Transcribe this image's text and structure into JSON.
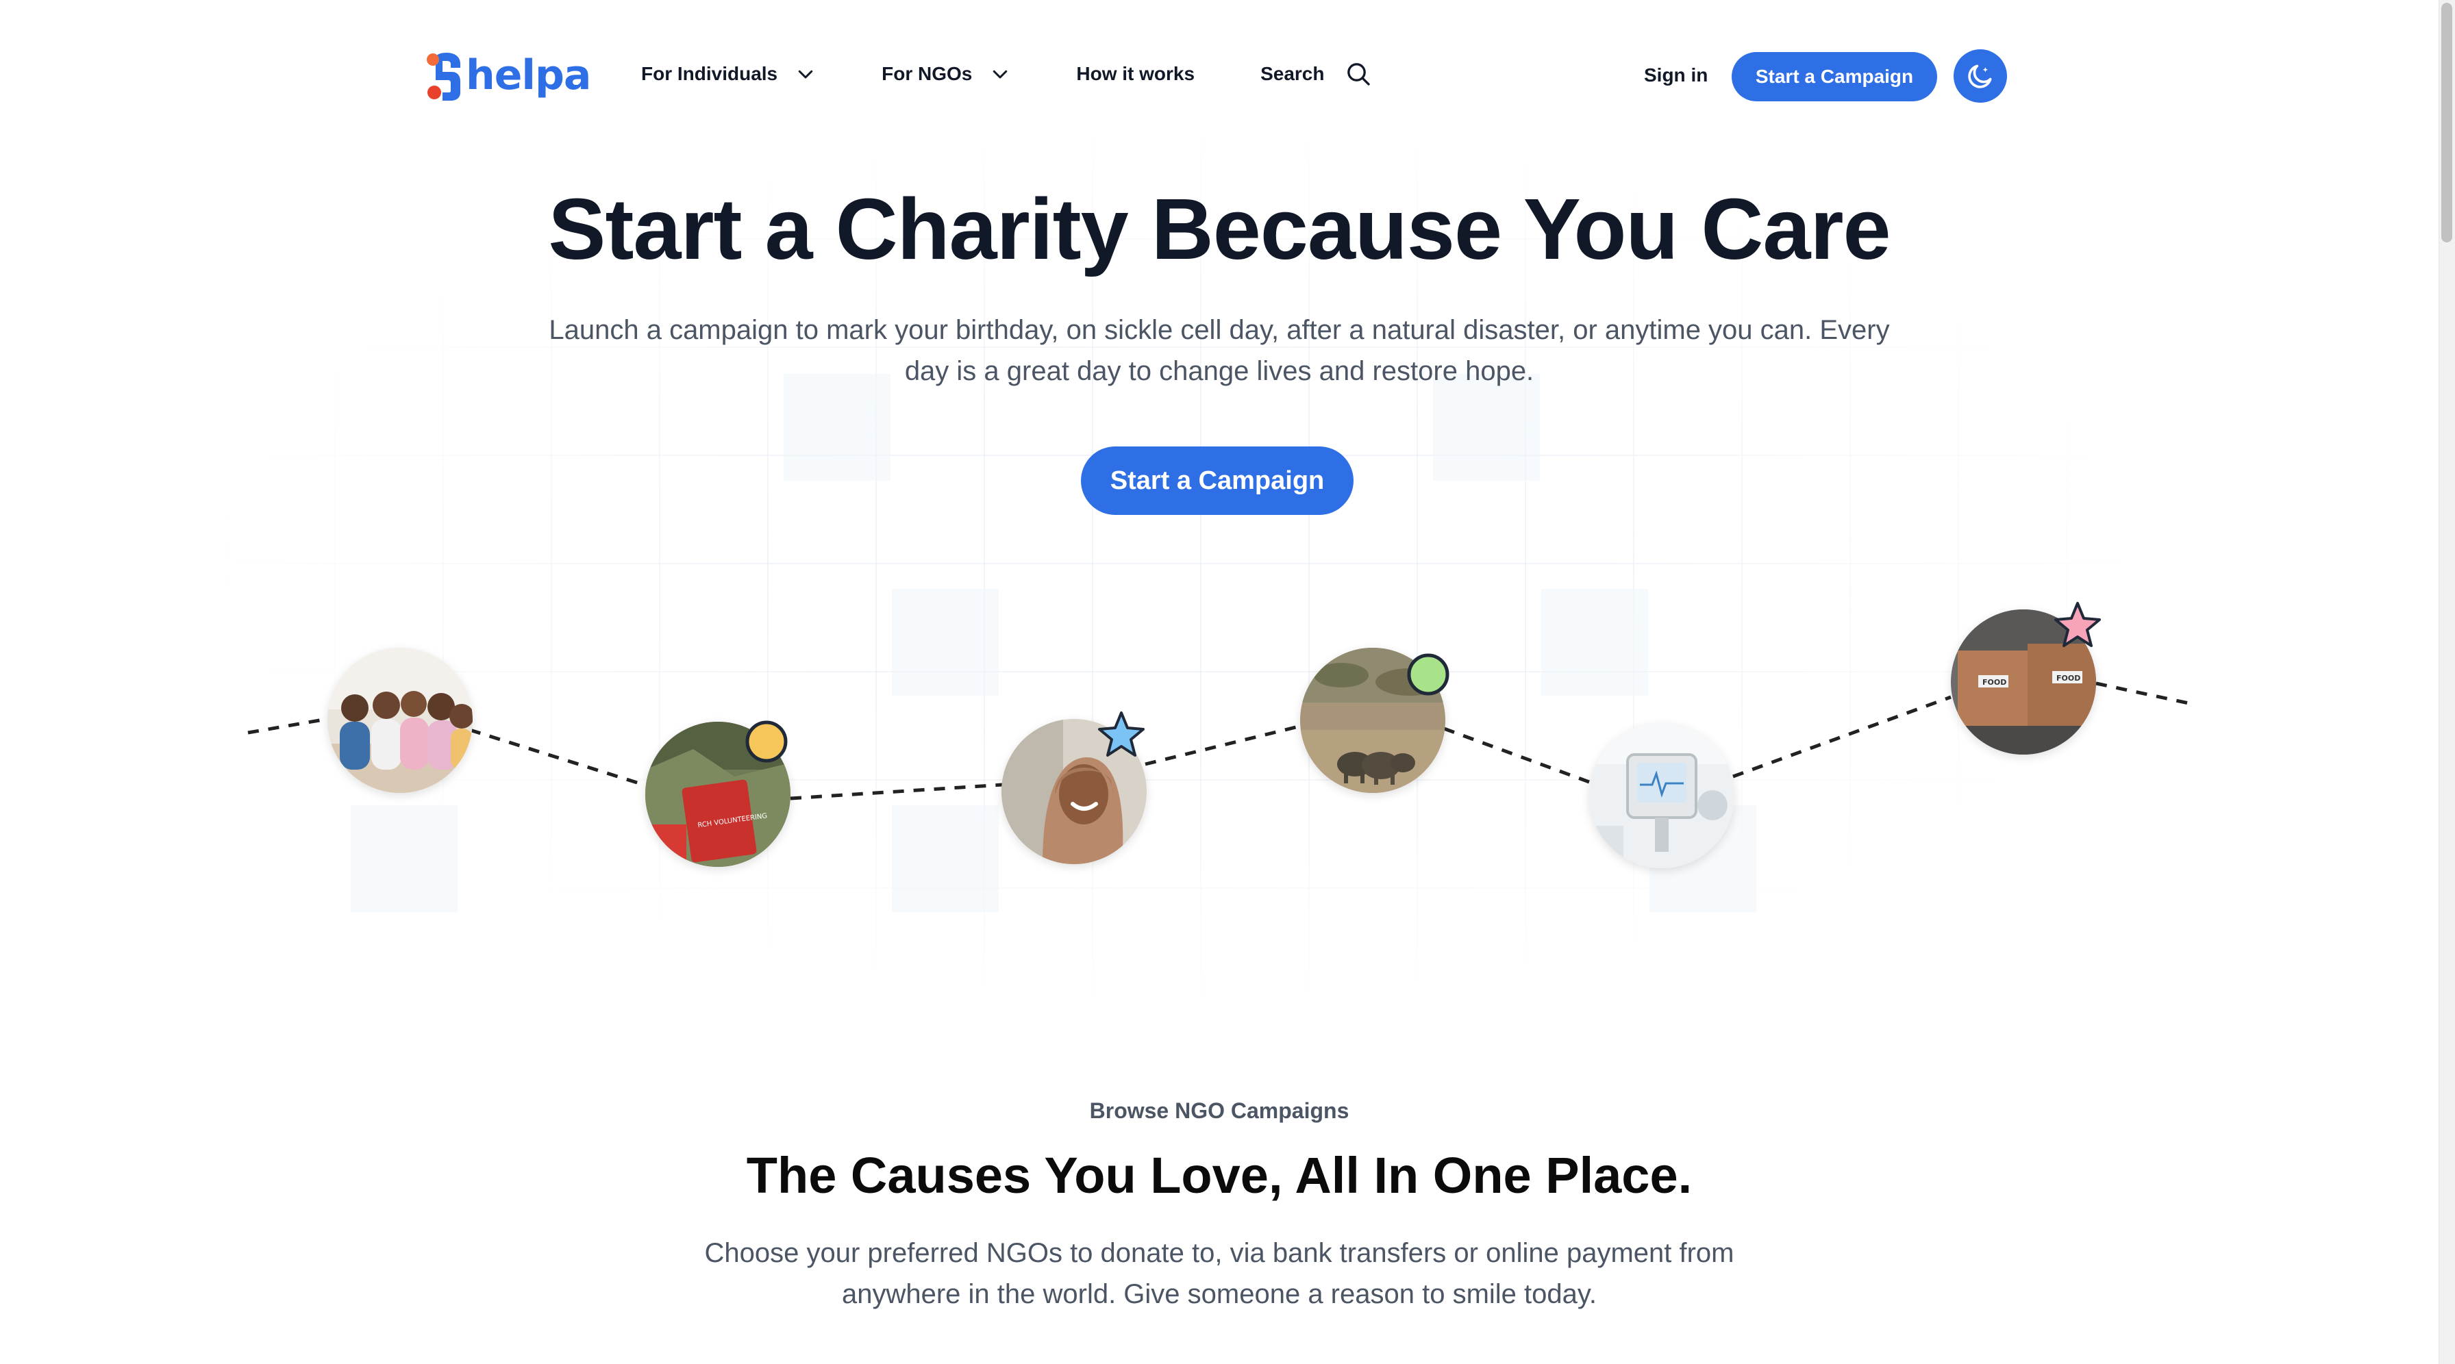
{
  "brand": {
    "name": "helpa",
    "primary_color": "#2f6fe6"
  },
  "nav": {
    "items": [
      {
        "label": "For Individuals",
        "has_dropdown": true
      },
      {
        "label": "For NGOs",
        "has_dropdown": true
      },
      {
        "label": "How it works",
        "has_dropdown": false
      },
      {
        "label": "Search",
        "icon": "search-icon"
      }
    ],
    "signin_label": "Sign in",
    "cta_label": "Start a Campaign",
    "theme_toggle_icon": "moon-icon"
  },
  "hero": {
    "title": "Start a Charity Because You Care",
    "subtitle": "Launch a campaign to mark your birthday, on sickle cell day, after a natural disaster, or anytime you can. Every day is a great day to change lives and restore hope.",
    "cta_label": "Start a Campaign"
  },
  "timeline": {
    "photos": [
      {
        "name": "group-of-friends-photo",
        "badge": null
      },
      {
        "name": "volunteering-book-photo",
        "badge": "yellow-dot"
      },
      {
        "name": "smiling-woman-hijab-photo",
        "badge": "blue-star"
      },
      {
        "name": "elephants-savanna-photo",
        "badge": "green-dot"
      },
      {
        "name": "hospital-monitor-photo",
        "badge": null
      },
      {
        "name": "food-boxes-photo",
        "badge": "pink-star"
      }
    ],
    "food_label": "FOOD",
    "book_label": "RCH VOLUNTEERING"
  },
  "browse": {
    "eyebrow": "Browse NGO Campaigns",
    "title": "The Causes You Love, All In One Place.",
    "subtitle": "Choose your preferred NGOs to donate to, via bank transfers or online payment from anywhere in the world. Give someone a reason to smile today."
  },
  "colors": {
    "badge_yellow": "#f6c65b",
    "badge_blue": "#7cc3f5",
    "badge_green": "#a8e38a",
    "badge_pink": "#f7a3b8"
  }
}
